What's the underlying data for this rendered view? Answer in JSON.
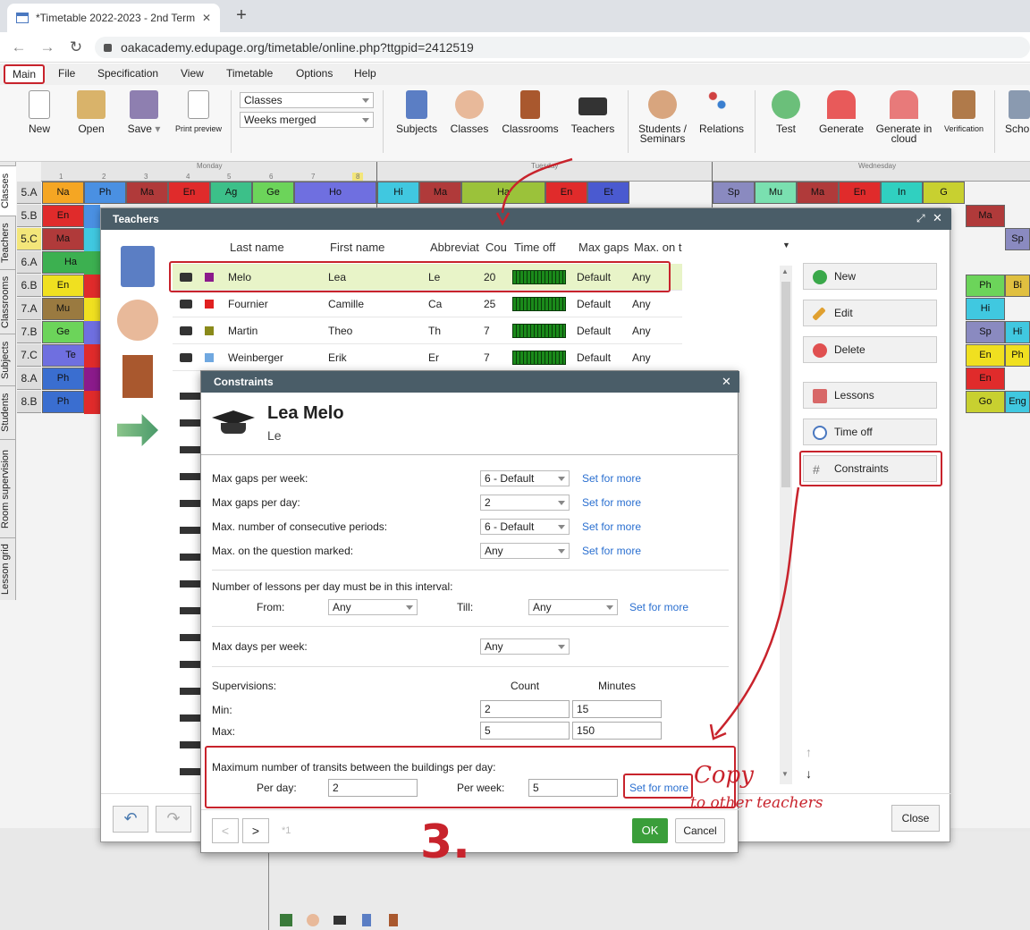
{
  "browser": {
    "tab_title": "*Timetable 2022-2023 - 2nd Term",
    "new_tab": "+",
    "url": "oakacademy.edupage.org/timetable/online.php?ttgpid=2412519",
    "close_tab": "✕"
  },
  "menu": [
    "Main",
    "File",
    "Specification",
    "View",
    "Timetable",
    "Options",
    "Help"
  ],
  "ribbon": {
    "new": "New",
    "open": "Open",
    "save": "Save",
    "print_preview": "Print preview",
    "view_select": "Classes",
    "weeks_select": "Weeks merged",
    "subjects": "Subjects",
    "classes": "Classes",
    "classrooms": "Classrooms",
    "teachers": "Teachers",
    "students_1": "Students /",
    "students_2": "Seminars",
    "relations": "Relations",
    "test": "Test",
    "generate": "Generate",
    "generate_cloud_1": "Generate in",
    "generate_cloud_2": "cloud",
    "verification": "Verification",
    "school": "Scho"
  },
  "timetable": {
    "days": [
      "Monday",
      "Tuesday",
      "Wednesday"
    ],
    "periods": [
      "1",
      "2",
      "3",
      "4",
      "5",
      "6",
      "7",
      "8"
    ],
    "rows": [
      "5.A",
      "5.B",
      "5.C",
      "6.A",
      "6.B",
      "7.A",
      "7.B",
      "7.C",
      "8.A",
      "8.B"
    ],
    "side_tabs": [
      "Classes",
      "Teachers",
      "Classrooms",
      "Subjects",
      "Students",
      "Room supervision",
      "Lesson grid"
    ],
    "row_5a": [
      "Na",
      "Ph",
      "Ma",
      "En",
      "Ag",
      "Ge",
      "Ho",
      "Hi",
      "Ma",
      "Ha",
      "En",
      "Et",
      "Sp",
      "Mu",
      "Ma",
      "En",
      "In",
      "G"
    ],
    "col_labels": [
      "En",
      "Ma",
      "Ha",
      "En",
      "Mu",
      "Ge",
      "Te",
      "Ph",
      "Ph"
    ],
    "right_col": [
      "Ma",
      "Sp",
      "Ph",
      "Hi",
      "Sp",
      "En",
      "En",
      "Go",
      "Bi",
      "Hi",
      "Ph",
      "Eng"
    ]
  },
  "teachers_dialog": {
    "title": "Teachers",
    "columns": [
      "Last name",
      "First name",
      "Abbreviat",
      "Cou",
      "Time off",
      "Max gaps",
      "Max. on t"
    ],
    "rows": [
      {
        "last": "Melo",
        "first": "Lea",
        "abbr": "Le",
        "count": "20",
        "gaps": "Default",
        "max": "Any",
        "color": "#8b1a8b"
      },
      {
        "last": "Fournier",
        "first": "Camille",
        "abbr": "Ca",
        "count": "25",
        "gaps": "Default",
        "max": "Any",
        "color": "#e02020"
      },
      {
        "last": "Martin",
        "first": "Theo",
        "abbr": "Th",
        "count": "7",
        "gaps": "Default",
        "max": "Any",
        "color": "#8a8a1a"
      },
      {
        "last": "Weinberger",
        "first": "Erik",
        "abbr": "Er",
        "count": "7",
        "gaps": "Default",
        "max": "Any",
        "color": "#70a8e0"
      }
    ],
    "buttons": {
      "new": "New",
      "edit": "Edit",
      "delete": "Delete",
      "lessons": "Lessons",
      "time_off": "Time off",
      "constraints": "Constraints"
    },
    "close": "Close"
  },
  "constraints_dialog": {
    "title": "Constraints",
    "name": "Lea Melo",
    "abbr": "Le",
    "max_gaps_week_label": "Max gaps per week:",
    "max_gaps_week_value": "6 - Default",
    "max_gaps_day_label": "Max gaps per day:",
    "max_gaps_day_value": "2",
    "max_consec_label": "Max. number of consecutive periods:",
    "max_consec_value": "6 - Default",
    "max_question_label": "Max. on the question marked:",
    "max_question_value": "Any",
    "set_for_more": "Set for more",
    "interval_label": "Number of lessons per day must be in this interval:",
    "from_label": "From:",
    "from_value": "Any",
    "till_label": "Till:",
    "till_value": "Any",
    "max_days_label": "Max days per week:",
    "max_days_value": "Any",
    "supervisions_label": "Supervisions:",
    "count_label": "Count",
    "minutes_label": "Minutes",
    "min_label": "Min:",
    "min_count": "2",
    "min_minutes": "15",
    "max_label": "Max:",
    "max_count": "5",
    "max_minutes": "150",
    "transit_label": "Maximum number of transits between the buildings per day:",
    "per_day_label": "Per day:",
    "per_day_value": "2",
    "per_week_label": "Per week:",
    "per_week_value": "5",
    "page_indicator": "*1",
    "ok": "OK",
    "cancel": "Cancel"
  },
  "annotations": {
    "copy_1": "Copy",
    "copy_2": "to other teachers",
    "step": "3."
  }
}
